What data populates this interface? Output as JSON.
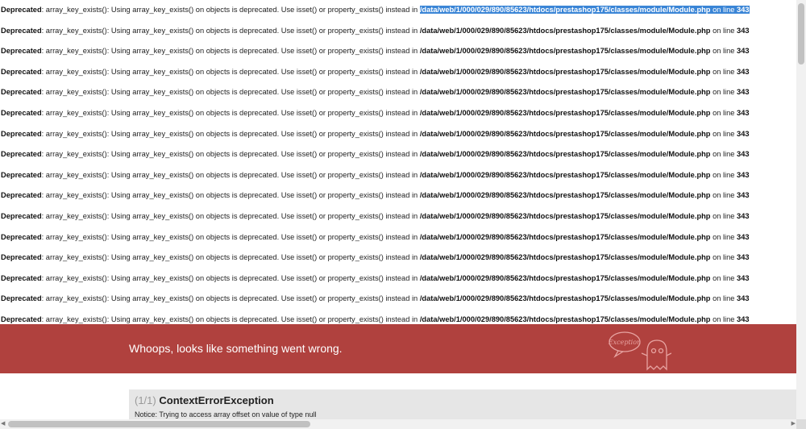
{
  "deprecations": [
    {
      "level": "Deprecated",
      "message": ": array_key_exists(): Using array_key_exists() on objects is deprecated. Use isset() or property_exists() instead in ",
      "file": "/data/web/1/000/029/890/85623/htdocs/prestashop175/classes/module/Module.php",
      "on_line": " on line ",
      "line": "343",
      "selected": true
    },
    {
      "level": "Deprecated",
      "message": ": array_key_exists(): Using array_key_exists() on objects is deprecated. Use isset() or property_exists() instead in ",
      "file": "/data/web/1/000/029/890/85623/htdocs/prestashop175/classes/module/Module.php",
      "on_line": " on line ",
      "line": "343"
    },
    {
      "level": "Deprecated",
      "message": ": array_key_exists(): Using array_key_exists() on objects is deprecated. Use isset() or property_exists() instead in ",
      "file": "/data/web/1/000/029/890/85623/htdocs/prestashop175/classes/module/Module.php",
      "on_line": " on line ",
      "line": "343"
    },
    {
      "level": "Deprecated",
      "message": ": array_key_exists(): Using array_key_exists() on objects is deprecated. Use isset() or property_exists() instead in ",
      "file": "/data/web/1/000/029/890/85623/htdocs/prestashop175/classes/module/Module.php",
      "on_line": " on line ",
      "line": "343"
    },
    {
      "level": "Deprecated",
      "message": ": array_key_exists(): Using array_key_exists() on objects is deprecated. Use isset() or property_exists() instead in ",
      "file": "/data/web/1/000/029/890/85623/htdocs/prestashop175/classes/module/Module.php",
      "on_line": " on line ",
      "line": "343"
    },
    {
      "level": "Deprecated",
      "message": ": array_key_exists(): Using array_key_exists() on objects is deprecated. Use isset() or property_exists() instead in ",
      "file": "/data/web/1/000/029/890/85623/htdocs/prestashop175/classes/module/Module.php",
      "on_line": " on line ",
      "line": "343"
    },
    {
      "level": "Deprecated",
      "message": ": array_key_exists(): Using array_key_exists() on objects is deprecated. Use isset() or property_exists() instead in ",
      "file": "/data/web/1/000/029/890/85623/htdocs/prestashop175/classes/module/Module.php",
      "on_line": " on line ",
      "line": "343"
    },
    {
      "level": "Deprecated",
      "message": ": array_key_exists(): Using array_key_exists() on objects is deprecated. Use isset() or property_exists() instead in ",
      "file": "/data/web/1/000/029/890/85623/htdocs/prestashop175/classes/module/Module.php",
      "on_line": " on line ",
      "line": "343"
    },
    {
      "level": "Deprecated",
      "message": ": array_key_exists(): Using array_key_exists() on objects is deprecated. Use isset() or property_exists() instead in ",
      "file": "/data/web/1/000/029/890/85623/htdocs/prestashop175/classes/module/Module.php",
      "on_line": " on line ",
      "line": "343"
    },
    {
      "level": "Deprecated",
      "message": ": array_key_exists(): Using array_key_exists() on objects is deprecated. Use isset() or property_exists() instead in ",
      "file": "/data/web/1/000/029/890/85623/htdocs/prestashop175/classes/module/Module.php",
      "on_line": " on line ",
      "line": "343"
    },
    {
      "level": "Deprecated",
      "message": ": array_key_exists(): Using array_key_exists() on objects is deprecated. Use isset() or property_exists() instead in ",
      "file": "/data/web/1/000/029/890/85623/htdocs/prestashop175/classes/module/Module.php",
      "on_line": " on line ",
      "line": "343"
    },
    {
      "level": "Deprecated",
      "message": ": array_key_exists(): Using array_key_exists() on objects is deprecated. Use isset() or property_exists() instead in ",
      "file": "/data/web/1/000/029/890/85623/htdocs/prestashop175/classes/module/Module.php",
      "on_line": " on line ",
      "line": "343"
    },
    {
      "level": "Deprecated",
      "message": ": array_key_exists(): Using array_key_exists() on objects is deprecated. Use isset() or property_exists() instead in ",
      "file": "/data/web/1/000/029/890/85623/htdocs/prestashop175/classes/module/Module.php",
      "on_line": " on line ",
      "line": "343"
    },
    {
      "level": "Deprecated",
      "message": ": array_key_exists(): Using array_key_exists() on objects is deprecated. Use isset() or property_exists() instead in ",
      "file": "/data/web/1/000/029/890/85623/htdocs/prestashop175/classes/module/Module.php",
      "on_line": " on line ",
      "line": "343"
    },
    {
      "level": "Deprecated",
      "message": ": array_key_exists(): Using array_key_exists() on objects is deprecated. Use isset() or property_exists() instead in ",
      "file": "/data/web/1/000/029/890/85623/htdocs/prestashop175/classes/module/Module.php",
      "on_line": " on line ",
      "line": "343"
    },
    {
      "level": "Deprecated",
      "message": ": array_key_exists(): Using array_key_exists() on objects is deprecated. Use isset() or property_exists() instead in ",
      "file": "/data/web/1/000/029/890/85623/htdocs/prestashop175/classes/module/Module.php",
      "on_line": " on line ",
      "line": "343"
    }
  ],
  "error_banner": {
    "message": "Whoops, looks like something went wrong.",
    "mascot_label": "Exception",
    "color": "#b0413e",
    "mascot_icon": "exception-ghost-icon"
  },
  "exception": {
    "count": "(1/1)",
    "name": "ContextErrorException",
    "notice": "Notice: Trying to access array offset on value of type null"
  },
  "colors": {
    "selection": "#3a85d6",
    "panel_bg": "#e6e6e6"
  }
}
